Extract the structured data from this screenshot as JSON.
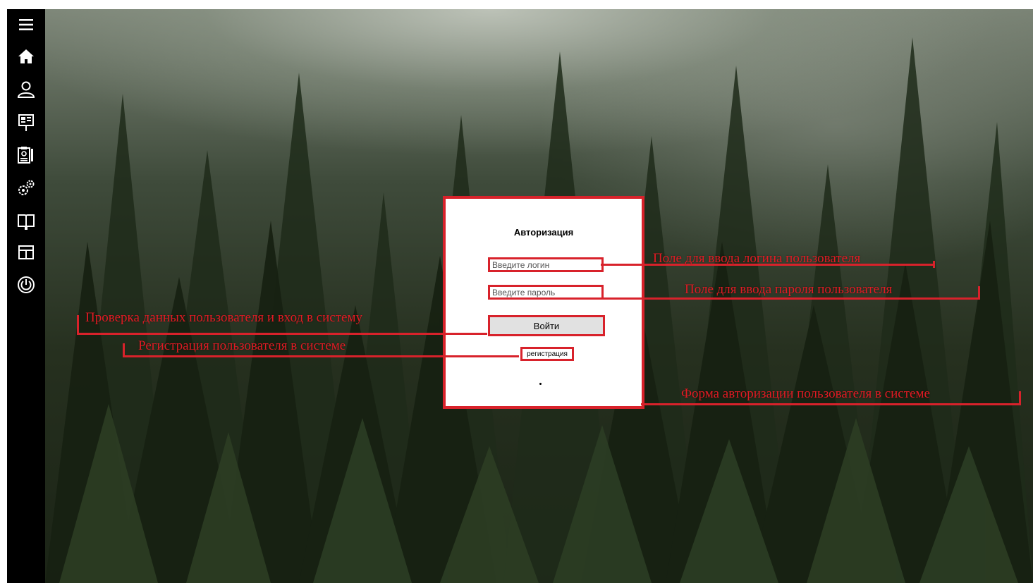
{
  "sidebar": {
    "items": [
      {
        "icon": "hamburger-menu-icon"
      },
      {
        "icon": "home-icon"
      },
      {
        "icon": "user-icon"
      },
      {
        "icon": "presentation-board-icon"
      },
      {
        "icon": "clipboard-report-icon"
      },
      {
        "icon": "gears-icon"
      },
      {
        "icon": "book-icon"
      },
      {
        "icon": "layout-panel-icon"
      },
      {
        "icon": "power-icon"
      }
    ]
  },
  "login_form": {
    "title": "Авторизация",
    "login_placeholder": "Введите логин",
    "password_placeholder": "Введите пароль",
    "submit_label": "Войти",
    "register_label": "регистрация",
    "dot": "•"
  },
  "annotations": {
    "login_field": "Поле для ввода логина пользователя",
    "password_field": "Поле для ввода пароля пользователя",
    "submit_button": "Проверка данных пользователя и вход в систему",
    "register_link": "Регистрация пользователя в системе",
    "form": "Форма авторизации пользователя в системе"
  },
  "colors": {
    "annotation": "#d8222b",
    "sidebar": "#000000",
    "form_bg": "#ffffff"
  }
}
